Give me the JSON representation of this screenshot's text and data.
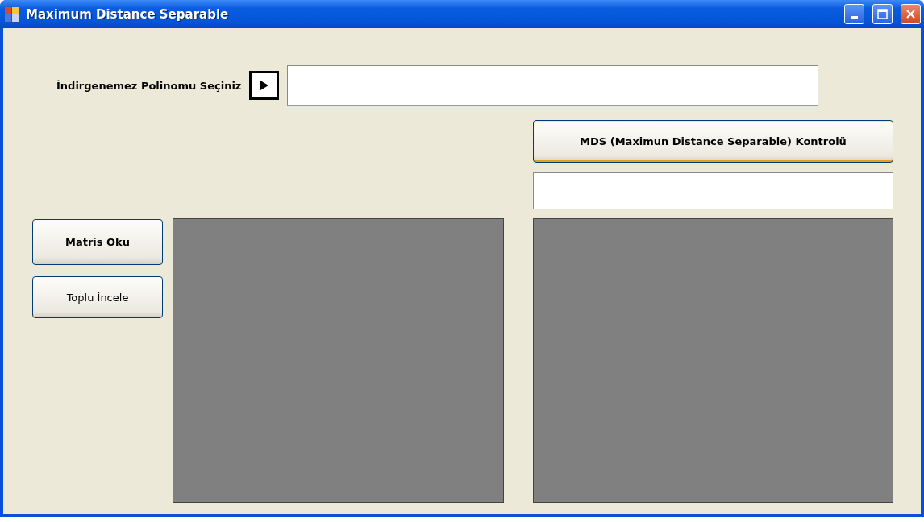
{
  "window": {
    "title": "Maximum Distance Separable"
  },
  "polynomial": {
    "label": "İndirgenemez Polinomu Seçiniz"
  },
  "check_button": {
    "label": "MDS (Maximun Distance Separable) Kontrolü",
    "focused": true
  },
  "side_buttons": [
    {
      "label": "Matris Oku",
      "kind": "bold",
      "focused": false
    },
    {
      "label": "Toplu İncele",
      "kind": "plain",
      "focused": false
    }
  ]
}
